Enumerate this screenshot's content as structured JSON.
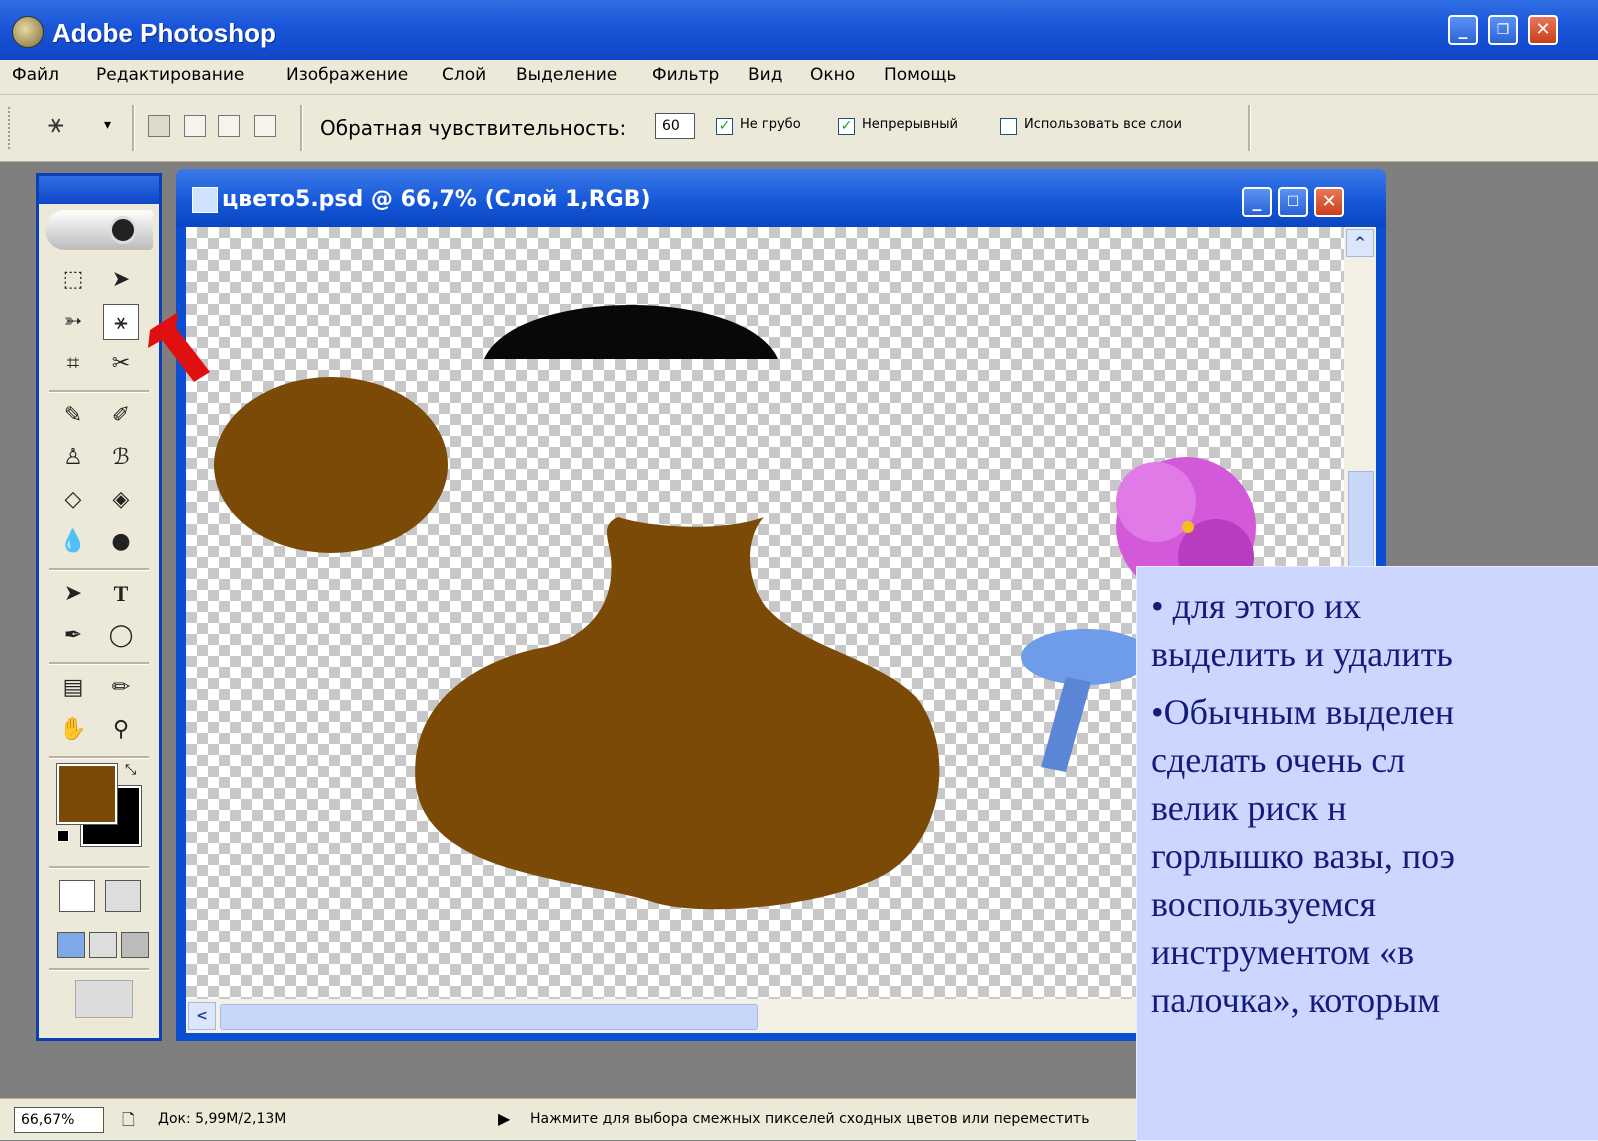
{
  "window": {
    "title": "Adobe Photoshop",
    "controls": [
      "minimize",
      "restore",
      "close"
    ]
  },
  "menu": [
    "Файл",
    "Редактирование",
    "Изображение",
    "Слой",
    "Выделение",
    "Фильтр",
    "Вид",
    "Окно",
    "Помощь"
  ],
  "options": {
    "tool_icon": "magic-wand-icon",
    "tolerance_label": "Обратная чувствительность:",
    "tolerance_value": "60",
    "anti_alias_label": "Не грубо",
    "anti_alias_checked": true,
    "contiguous_label": "Непрерывный",
    "contiguous_checked": true,
    "all_layers_label": "Использовать все слои",
    "all_layers_checked": false
  },
  "document": {
    "title": "цвето5.psd @ 66,7% (Слой 1,RGB)"
  },
  "colors": {
    "foreground": "#7a4a06",
    "background": "#000000",
    "xp_blue": "#0e46c8",
    "shape_brown": "#7a4a06"
  },
  "statusbar": {
    "zoom": "66,67%",
    "doc_info": "Док: 5,99M/2,13M",
    "hint": "Нажмите для выбора смежных пикселей сходных цветов или переместить"
  },
  "note": {
    "lines": [
      "•   для    этого   их",
      "выделить и удалить",
      "•Обычным   выделен",
      "сделать   очень   сл",
      "велик       риск       н",
      "горлышко вазы, поэ",
      "воспользуемся",
      "инструментом    «в",
      "палочка»,   которым"
    ]
  }
}
